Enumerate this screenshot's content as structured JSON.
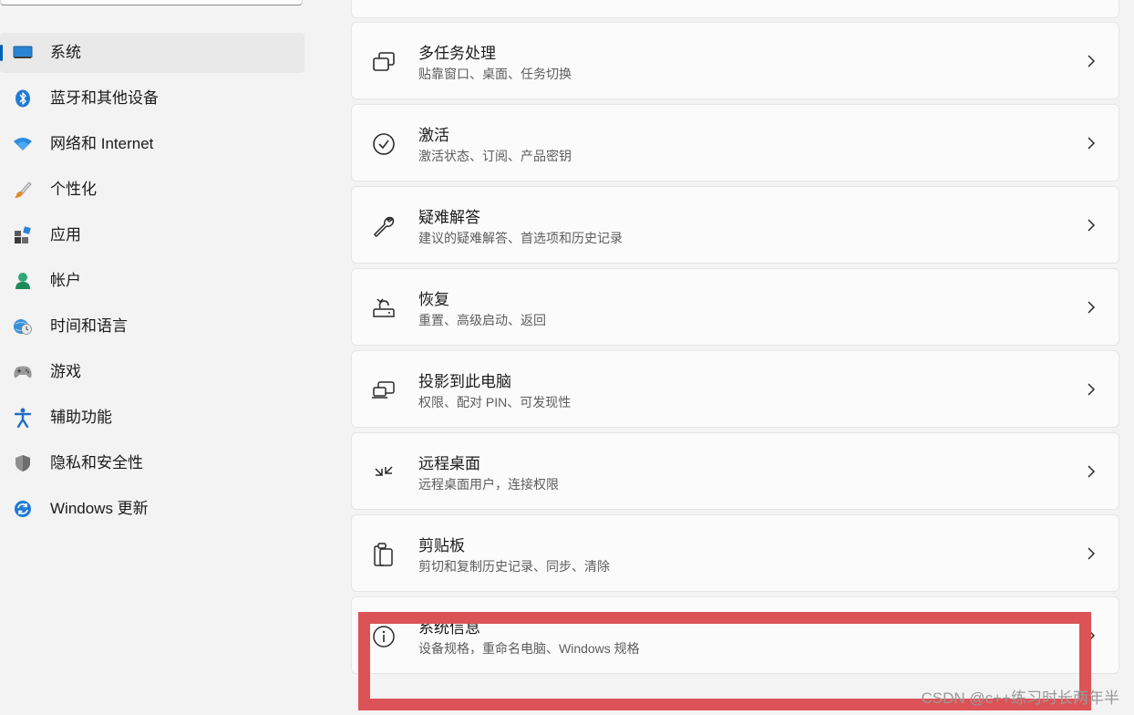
{
  "sidebar": {
    "items": [
      {
        "label": "系统",
        "icon": "monitor-icon",
        "selected": true
      },
      {
        "label": "蓝牙和其他设备",
        "icon": "bluetooth-icon",
        "selected": false
      },
      {
        "label": "网络和 Internet",
        "icon": "wifi-icon",
        "selected": false
      },
      {
        "label": "个性化",
        "icon": "brush-icon",
        "selected": false
      },
      {
        "label": "应用",
        "icon": "apps-icon",
        "selected": false
      },
      {
        "label": "帐户",
        "icon": "account-icon",
        "selected": false
      },
      {
        "label": "时间和语言",
        "icon": "globe-clock-icon",
        "selected": false
      },
      {
        "label": "游戏",
        "icon": "gamepad-icon",
        "selected": false
      },
      {
        "label": "辅助功能",
        "icon": "accessibility-icon",
        "selected": false
      },
      {
        "label": "隐私和安全性",
        "icon": "shield-icon",
        "selected": false
      },
      {
        "label": "Windows 更新",
        "icon": "update-icon",
        "selected": false
      }
    ]
  },
  "main": {
    "cards": [
      {
        "title": "多任务处理",
        "subtitle": "贴靠窗口、桌面、任务切换",
        "icon": "multitasking-icon"
      },
      {
        "title": "激活",
        "subtitle": "激活状态、订阅、产品密钥",
        "icon": "check-circle-icon"
      },
      {
        "title": "疑难解答",
        "subtitle": "建议的疑难解答、首选项和历史记录",
        "icon": "wrench-icon"
      },
      {
        "title": "恢复",
        "subtitle": "重置、高级启动、返回",
        "icon": "recovery-icon"
      },
      {
        "title": "投影到此电脑",
        "subtitle": "权限、配对 PIN、可发现性",
        "icon": "project-icon"
      },
      {
        "title": "远程桌面",
        "subtitle": "远程桌面用户，连接权限",
        "icon": "remote-desktop-icon"
      },
      {
        "title": "剪贴板",
        "subtitle": "剪切和复制历史记录、同步、清除",
        "icon": "clipboard-icon"
      },
      {
        "title": "系统信息",
        "subtitle": "设备规格，重命名电脑、Windows 规格",
        "icon": "info-icon"
      }
    ]
  },
  "colors": {
    "accent": "#005fb8",
    "annotation": "#dc5357"
  },
  "watermark": "CSDN @c++练习时长两年半"
}
